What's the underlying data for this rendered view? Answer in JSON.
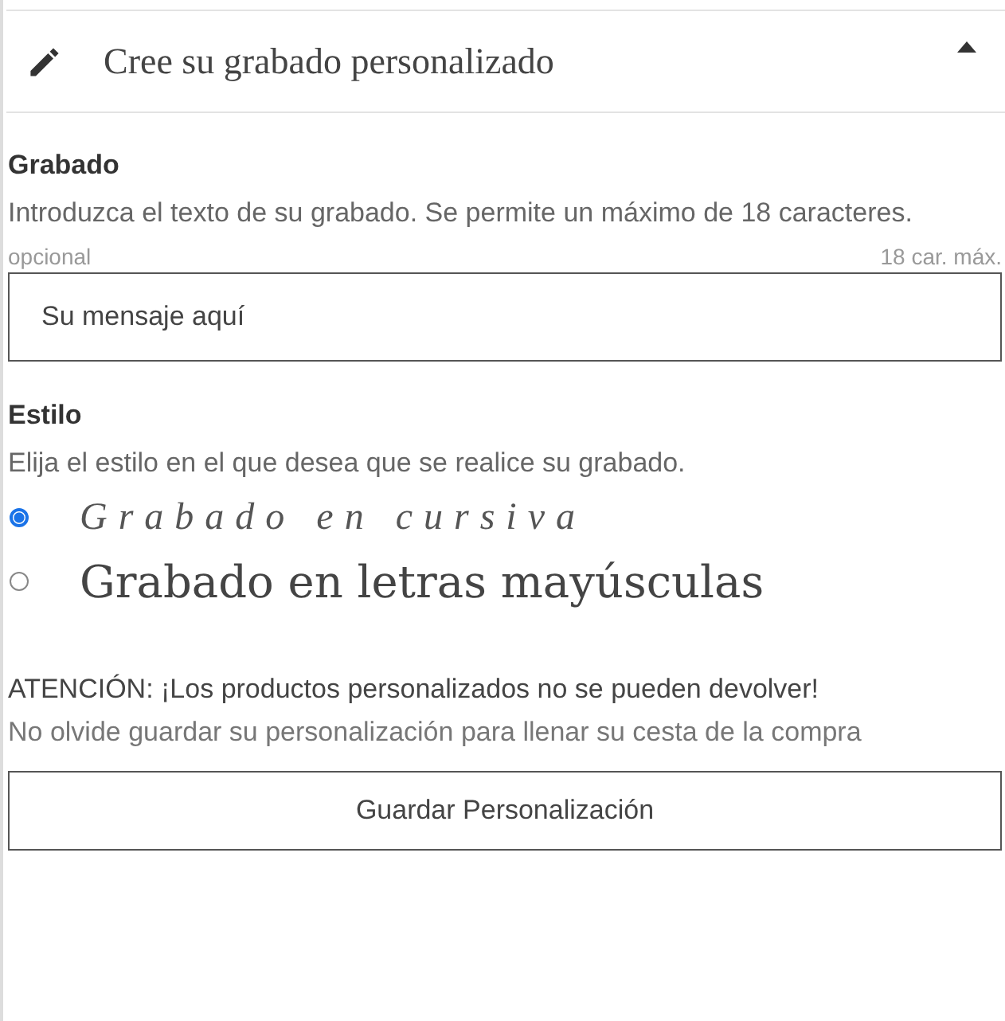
{
  "header": {
    "title": "Cree su grabado personalizado",
    "expanded": true
  },
  "engraving": {
    "label": "Grabado",
    "help": "Introduzca el texto de su grabado. Se permite un máximo de 18 caracteres.",
    "optional": "opcional",
    "limit": "18 car. máx.",
    "placeholder": "Su mensaje aquí"
  },
  "style": {
    "label": "Estilo",
    "help": "Elija el estilo en el que desea que se realice su grabado.",
    "options": [
      {
        "label": "Grabado en cursiva",
        "kind": "script",
        "selected": true
      },
      {
        "label": "Grabado en letras mayúsculas",
        "kind": "serif",
        "selected": false
      }
    ]
  },
  "warning": "ATENCIÓN: ¡Los productos personalizados no se pueden devolver!",
  "reminder": "No olvide guardar su personalización para llenar su cesta de la compra",
  "save_button": "Guardar Personalización"
}
